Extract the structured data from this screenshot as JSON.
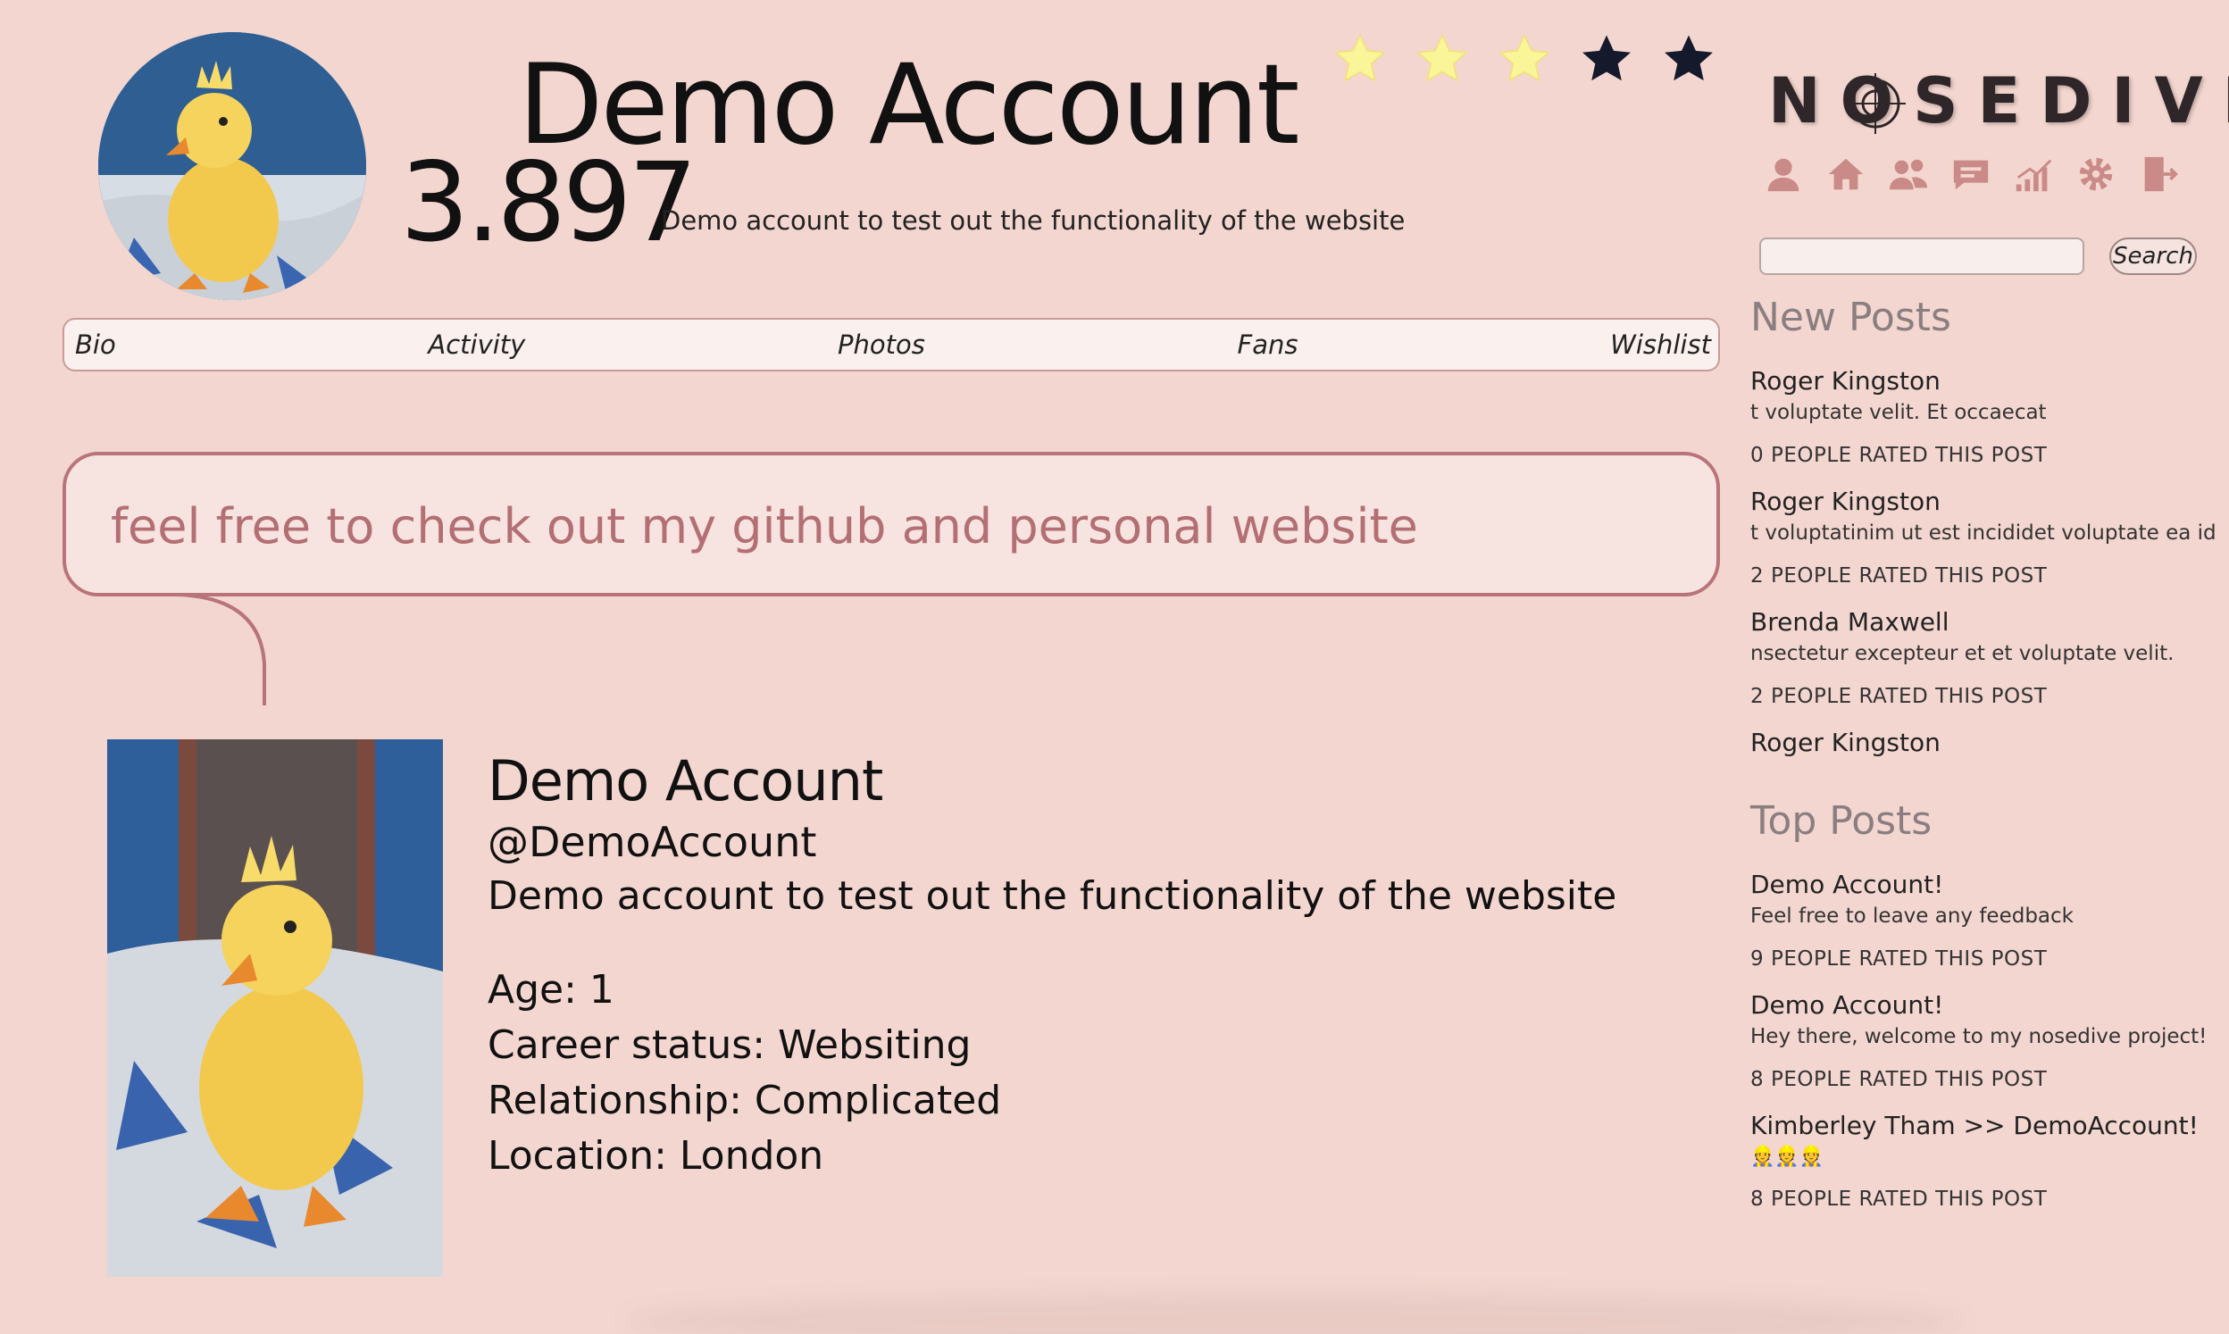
{
  "header": {
    "display_name": "Demo Account",
    "rating_score": "3.897",
    "short_bio": "Demo account to test out the functionality of the website",
    "star_rating": 3
  },
  "tabs": [
    {
      "label": "Bio"
    },
    {
      "label": "Activity"
    },
    {
      "label": "Photos"
    },
    {
      "label": "Fans"
    },
    {
      "label": "Wishlist"
    }
  ],
  "bubble": {
    "text": "feel free to check out my github and personal website"
  },
  "profile": {
    "name": "Demo Account",
    "handle": "@DemoAccount",
    "description": "Demo account to test out the functionality of the website",
    "age": "Age: 1",
    "career": "Career status: Websiting",
    "relationship": "Relationship: Complicated",
    "location": "Location: London"
  },
  "sidebar": {
    "logo": "NOSEDIVE",
    "nav_icons": [
      "profile-icon",
      "home-icon",
      "friends-icon",
      "messages-icon",
      "stats-icon",
      "settings-icon",
      "logout-icon"
    ],
    "search_placeholder": "",
    "search_label": "Search",
    "new_posts_title": "New Posts",
    "new_posts": [
      {
        "author": "Roger Kingston",
        "excerpt": "t voluptate velit. Et occaecat",
        "rated": "0 PEOPLE RATED THIS POST"
      },
      {
        "author": "Roger Kingston",
        "excerpt": "t voluptatinim ut est incididet voluptate ea id amet.",
        "rated": "2 PEOPLE RATED THIS POST"
      },
      {
        "author": "Brenda Maxwell",
        "excerpt": "nsectetur excepteur et et voluptate velit.",
        "rated": "2 PEOPLE RATED THIS POST"
      },
      {
        "author": "Roger Kingston",
        "excerpt": "",
        "rated": ""
      }
    ],
    "top_posts_title": "Top Posts",
    "top_posts": [
      {
        "author": "Demo Account!",
        "excerpt": "Feel free to leave any feedback",
        "rated": "9 PEOPLE RATED THIS POST"
      },
      {
        "author": "Demo Account!",
        "excerpt": "Hey there, welcome to my nosedive project!",
        "rated": "8 PEOPLE RATED THIS POST"
      },
      {
        "author": "Kimberley Tham >> DemoAccount!",
        "excerpt": "👷👷👷",
        "rated": "8 PEOPLE RATED THIS POST"
      }
    ]
  },
  "colors": {
    "background": "#f3d6cf",
    "star_filled": "#fbf59a",
    "star_empty": "#14192c",
    "bubble_border": "#b8747a",
    "bubble_text": "#b36f73"
  }
}
